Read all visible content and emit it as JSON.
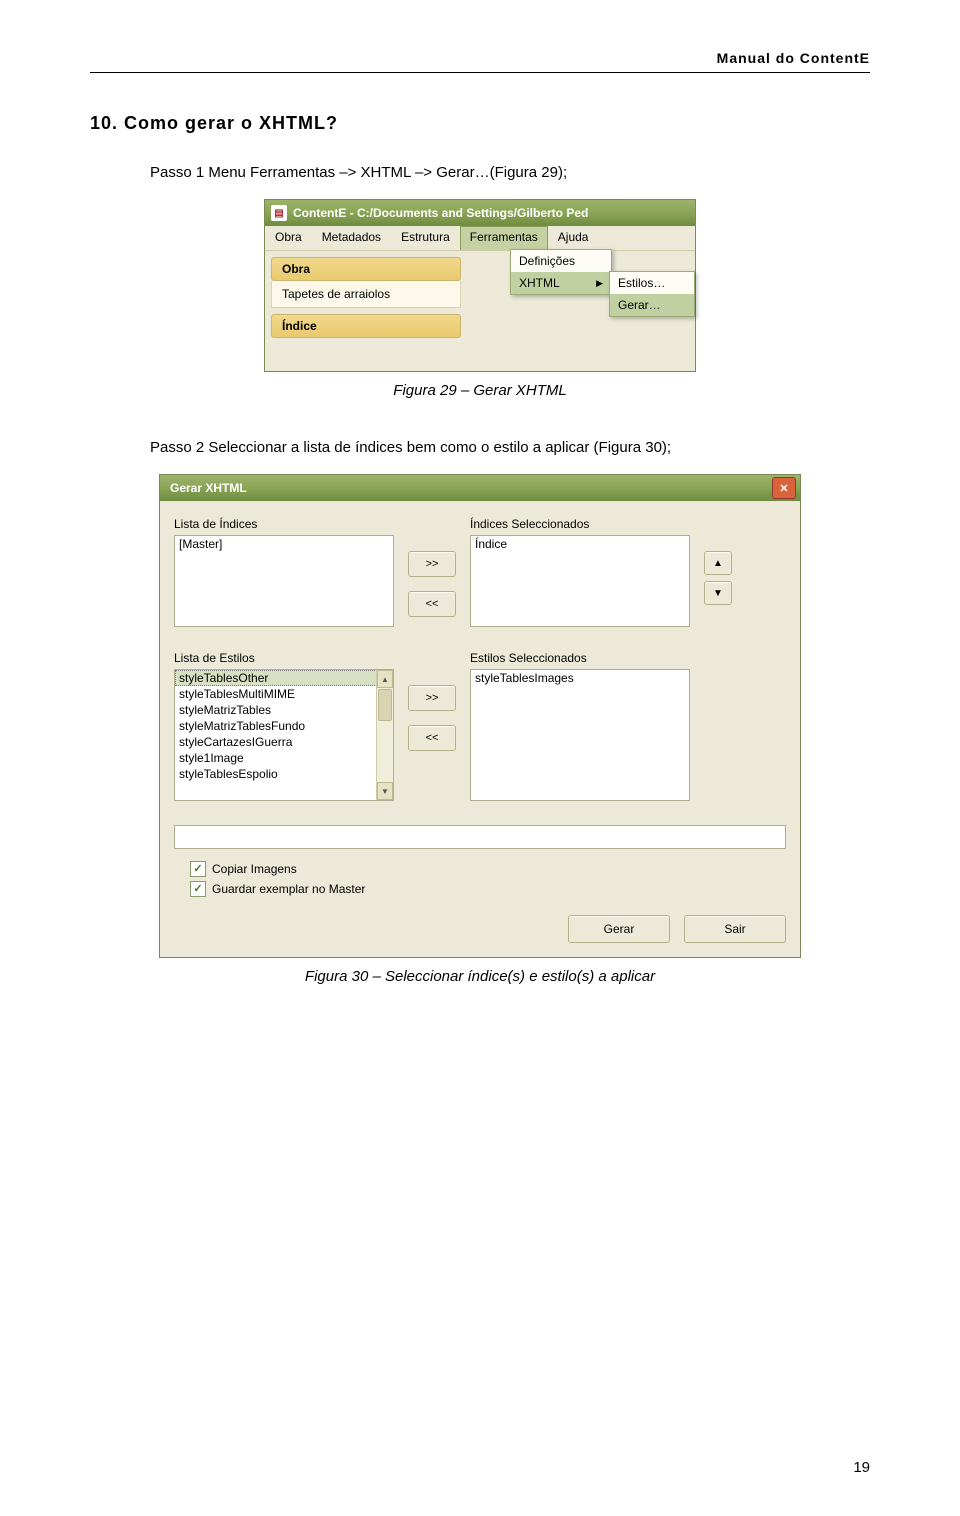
{
  "header": {
    "title": "Manual do ContentE"
  },
  "section": {
    "title": "10. Como gerar o XHTML?"
  },
  "step1": {
    "text": "Passo 1 Menu Ferramentas –> XHTML –> Gerar…(Figura 29);"
  },
  "fig29": {
    "caption": "Figura 29 – Gerar XHTML",
    "window_title": "ContentE - C:/Documents and Settings/Gilberto Ped",
    "menubar": {
      "obra": "Obra",
      "metadados": "Metadados",
      "estrutura": "Estrutura",
      "ferramentas": "Ferramentas",
      "ajuda": "Ajuda"
    },
    "side": {
      "obra_head": "Obra",
      "obra_item": "Tapetes de arraiolos",
      "indice_head": "Índice"
    },
    "dropdown": {
      "definicoes": "Definições",
      "xhtml": "XHTML"
    },
    "submenu": {
      "estilos": "Estilos…",
      "gerar": "Gerar…"
    }
  },
  "step2": {
    "text": "Passo 2 Seleccionar a lista de índices bem como o estilo a aplicar (Figura 30);"
  },
  "fig30": {
    "caption": "Figura 30 – Seleccionar índice(s) e estilo(s) a aplicar",
    "title": "Gerar XHTML",
    "labels": {
      "lista_indices": "Lista de Índices",
      "indices_sel": "Índices Seleccionados",
      "lista_estilos": "Lista de Estilos",
      "estilos_sel": "Estilos Seleccionados"
    },
    "indices_src": [
      "[Master]"
    ],
    "indices_dst": [
      "Índice"
    ],
    "estilos_src": [
      "styleTablesOther",
      "styleTablesMultiMIME",
      "styleMatrizTables",
      "styleMatrizTablesFundo",
      "styleCartazesIGuerra",
      "style1Image",
      "styleTablesEspolio"
    ],
    "estilos_dst": [
      "styleTablesImages"
    ],
    "midbtns": {
      "add": ">>",
      "remove": "<<"
    },
    "updown": {
      "up": "▲",
      "down": "▼"
    },
    "checks": {
      "copiar": "Copiar Imagens",
      "guardar": "Guardar exemplar no Master"
    },
    "buttons": {
      "gerar": "Gerar",
      "sair": "Sair"
    }
  },
  "page_number": "19"
}
